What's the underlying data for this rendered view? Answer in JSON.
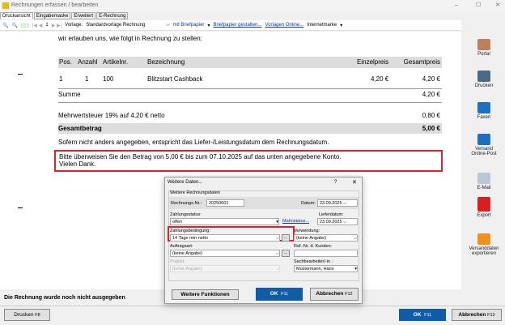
{
  "window": {
    "title": "Rechnungen erfassen / bearbeiten"
  },
  "tabs": [
    "Druckansicht",
    "Eingabemaske",
    "Erweitert",
    "E-Rechnung"
  ],
  "toolbar": {
    "page": "1",
    "template_label": "Vorlage:",
    "template": "Standardvorlage Rechnung",
    "letterhead": "mit Briefpapier",
    "design_link": "Briefpapier gestalten...",
    "online_link": "Vorlagen Online...",
    "stamp": "Internetmarke"
  },
  "doc": {
    "intro": "wir erlauben uns, wie folgt in Rechnung zu stellen:",
    "headers": [
      "Pos.",
      "Anzahl",
      "Artikelnr.",
      "Bezeichnung",
      "Einzelpreis",
      "Gesamtpreis"
    ],
    "row": [
      "1",
      "1",
      "100",
      "Blitzstart Cashback",
      "4,20 €",
      "4,20 €"
    ],
    "sum_label": "Summe",
    "sum": "4,20 €",
    "vat_label": "Mehrwertsteuer 19% auf 4,20 € netto",
    "vat": "0,80 €",
    "total_label": "Gesamtbetrag",
    "total": "5,00 €",
    "note": "Sofern nicht anders angegeben, entspricht das Liefer-/Leistungsdatum dem Rechnungsdatum.",
    "payment_line1": "Bitte überweisen Sie den Betrag von 5,00 € bis zum 07.10.2025 auf das unten angegebene Konto.",
    "payment_line2": "Vielen Dank."
  },
  "sidebar": [
    "Portal",
    "Drucken",
    "Faxen",
    "Versand Online-Post",
    "E-Mail",
    "Export",
    "Versanddaten exportieren"
  ],
  "status": "Die Rechnung wurde noch nicht ausgegeben",
  "bottom": {
    "print": "Drucken",
    "print_key": "F8",
    "ok": "OK",
    "ok_key": "F11",
    "cancel": "Abbrechen",
    "cancel_key": "F12"
  },
  "dialog": {
    "title": "Weitere Daten...",
    "help": "?",
    "group": "Weitere Rechnungsdaten",
    "invoice_no_label": "Rechnungs-Nr.:",
    "invoice_no": "20250001",
    "date_label": "Datum:",
    "date": "23.09.2025",
    "status_label": "Zahlungsstatus:",
    "status": "offen",
    "dunning_link": "Mahnstatus...",
    "delivery_label": "Lieferdatum:",
    "delivery": "23.09.2025",
    "terms_label": "Zahlungsbedingung:",
    "terms": "14 Tage rein netto",
    "usage_label": "Verwendung:",
    "usage": "(keine Angabe)",
    "order_label": "Auftragsart:",
    "order": "(keine Angabe)",
    "ref_label": "Ref.-Nr. d. Kunden:",
    "ref": "",
    "project_label": "Projekt:",
    "project": "(keine Angabe)",
    "clerk_label": "Sachbearbeiter/-in :",
    "clerk": "Mustermann, Hans",
    "more": "Weitere Funktionen",
    "ok": "OK",
    "ok_key": "F11",
    "cancel": "Abbrechen",
    "cancel_key": "F12",
    "dots": "..."
  },
  "colors": {
    "highlight": "#e0202a",
    "primary": "#0f5ca8"
  }
}
